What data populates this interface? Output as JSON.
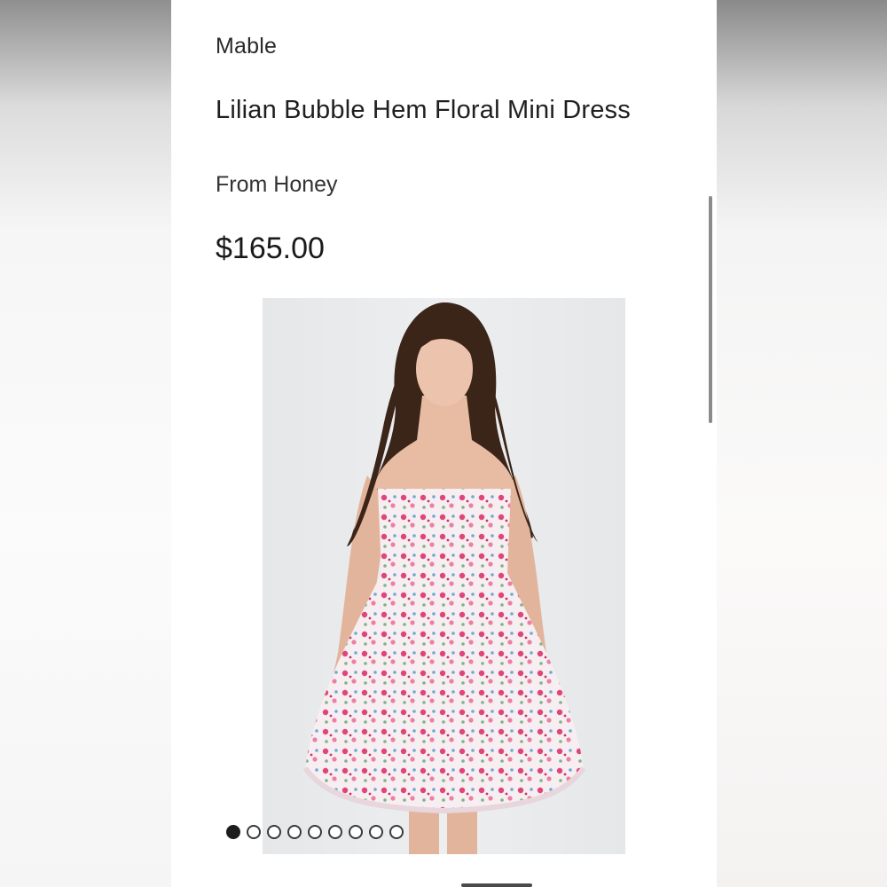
{
  "product": {
    "brand": "Mable",
    "title": "Lilian Bubble Hem Floral Mini Dress",
    "seller": "From Honey",
    "price": "$165.00"
  },
  "gallery": {
    "image_count": 9,
    "active_index": 0
  },
  "colors": {
    "dress_base": "#f6eef0",
    "floral_pink": "#e0457a",
    "floral_blue": "#6fa9d6",
    "hair": "#3b2418"
  }
}
